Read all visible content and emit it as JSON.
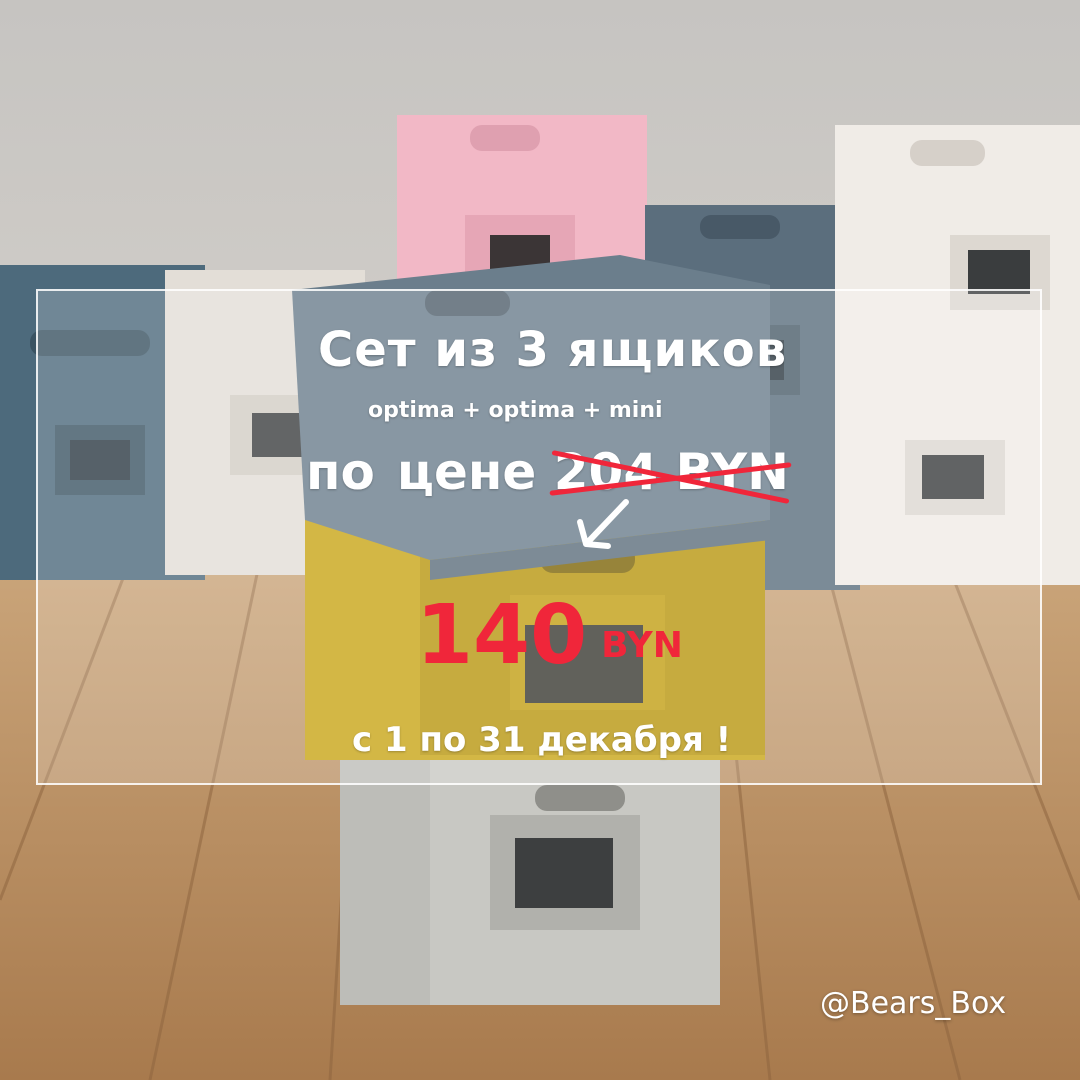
{
  "promo": {
    "headline": "Сет из 3 ящиков",
    "subline": "optima + optima + mini",
    "price_prefix_1": "по",
    "price_prefix_2": "цене",
    "old_price": "204 BYN",
    "new_price_amount": "140",
    "new_price_currency": "BYN",
    "dates": "с 1 по 31 декабря !"
  },
  "watermark": {
    "handle": "@Bears_Box"
  },
  "colors": {
    "text": "#ffffff",
    "accent_red": "#f0263a",
    "box_slate": "#6c7f8c",
    "box_mustard": "#c9a517",
    "box_grey": "#b9bab6",
    "box_pink": "#f2b8c6",
    "box_white": "#eeeae4",
    "floor_wood": "#b98f63"
  },
  "icons": {
    "arrow": "arrow-down-left-icon",
    "strike": "strikethrough-icon"
  }
}
